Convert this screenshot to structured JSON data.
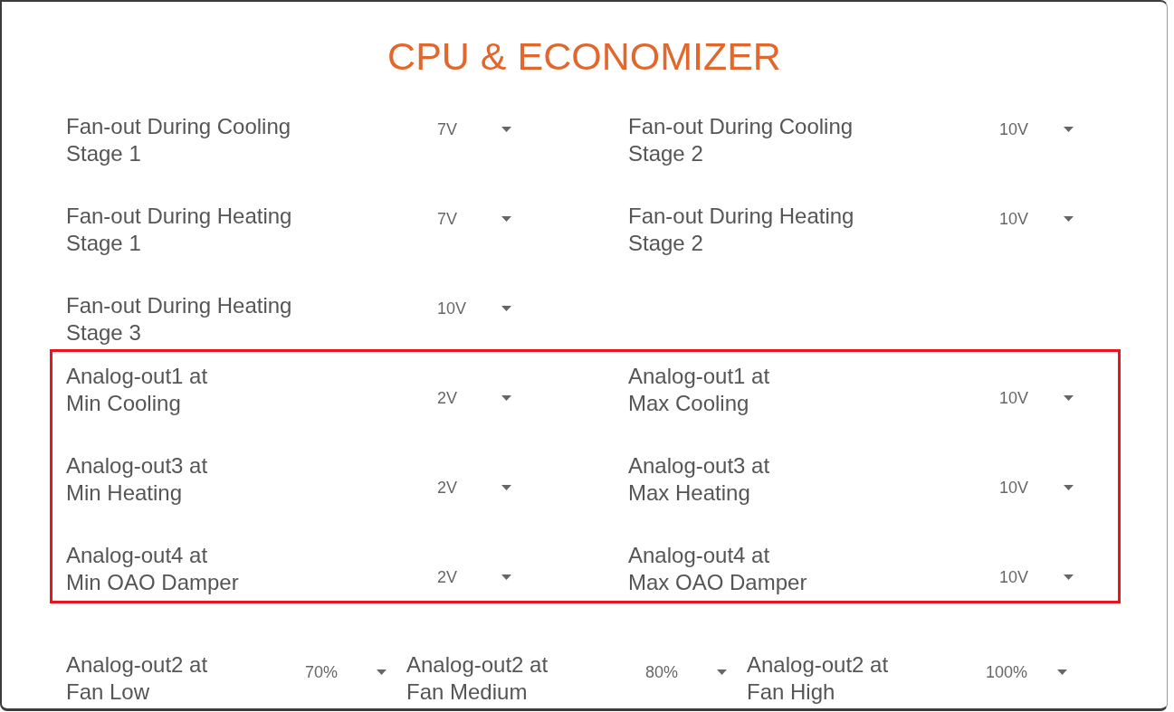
{
  "dialog": {
    "title": "CPU & ECONOMIZER"
  },
  "sections": [
    {
      "kind": "stages",
      "highlighted": false,
      "settings": [
        {
          "label": "Fan-out During Cooling\nStage 1",
          "value": "7V"
        },
        {
          "label": "Fan-out During Cooling\nStage 2",
          "value": "10V"
        },
        {
          "label": "Fan-out During Heating\nStage 1",
          "value": "7V"
        },
        {
          "label": "Fan-out During Heating\nStage 2",
          "value": "10V"
        },
        {
          "label": "Fan-out During Heating\nStage 3",
          "value": "10V"
        }
      ]
    },
    {
      "kind": "ranges",
      "highlighted": true,
      "settings": [
        {
          "label": "Analog-out1 at\nMin Cooling",
          "value": "2V"
        },
        {
          "label": "Analog-out1 at\nMax Cooling",
          "value": "10V"
        },
        {
          "label": "Analog-out3 at\nMin Heating",
          "value": "2V"
        },
        {
          "label": "Analog-out3 at\nMax Heating",
          "value": "10V"
        },
        {
          "label": "Analog-out4 at\nMin OAO Damper",
          "value": "2V"
        },
        {
          "label": "Analog-out4 at\nMax OAO Damper",
          "value": "10V"
        }
      ]
    },
    {
      "kind": "speeds",
      "highlighted": false,
      "settings": [
        {
          "label": "Analog-out2 at\nFan Low",
          "value": "70%"
        },
        {
          "label": "Analog-out2 at\nFan Medium",
          "value": "80%"
        },
        {
          "label": "Analog-out2 at\nFan High",
          "value": "100%"
        }
      ]
    }
  ]
}
